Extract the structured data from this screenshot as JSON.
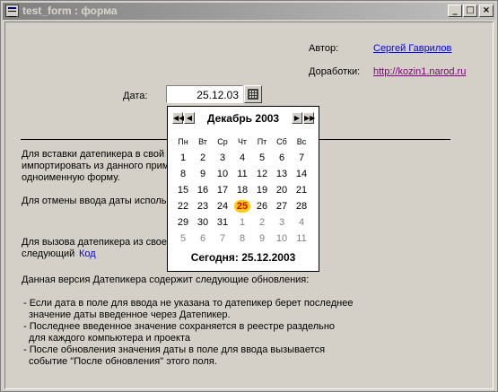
{
  "window": {
    "title": "test_form : форма"
  },
  "header": {
    "author_label": "Автор:",
    "author_link": "Сергей Гаврилов",
    "mods_label": "Доработки:",
    "mods_link": "http://kozin1.narod.ru"
  },
  "date_field": {
    "label": "Дата:",
    "value": "25.12.03"
  },
  "body_text": {
    "p1_line1": "Для вставки датепикера в свой",
    "p1_line2": "импортировать из данного прим",
    "p1_line3": "одноименную форму.",
    "p2_line1": "Для отмены ввода даты исполь",
    "p3_line1": "Для вызова датепикера из свое",
    "p3_line2": "следующий",
    "p3_link": "Код",
    "p4_line1": "Данная версия Датепикера содержит следующие обновления:",
    "b1_line1": "- Если дата в поле для ввода не указана то датепикер берет последнее",
    "b1_line2": "  значение даты введенное через Датепикер.",
    "b2_line1": "- Последнее введенное значение сохраняется в реестре раздельно",
    "b2_line2": "  для каждого компьютера и проекта",
    "b3_line1": "- После обновления значения даты в поле для ввода вызывается",
    "b3_line2": "  событие \"После обновления\" этого поля."
  },
  "calendar": {
    "month_year": "Декабрь 2003",
    "nav_prev_year": "◀◀",
    "nav_prev_month": "◀",
    "nav_next_month": "▶",
    "nav_next_year": "▶▶",
    "weekdays": [
      "Пн",
      "Вт",
      "Ср",
      "Чт",
      "Пт",
      "Сб",
      "Вс"
    ],
    "weeks": [
      [
        "1",
        "2",
        "3",
        "4",
        "5",
        "6",
        "7"
      ],
      [
        "8",
        "9",
        "10",
        "11",
        "12",
        "13",
        "14"
      ],
      [
        "15",
        "16",
        "17",
        "18",
        "19",
        "20",
        "21"
      ],
      [
        "22",
        "23",
        "24",
        "25",
        "26",
        "27",
        "28"
      ],
      [
        "29",
        "30",
        "31",
        "1",
        "2",
        "3",
        "4"
      ],
      [
        "5",
        "6",
        "7",
        "8",
        "9",
        "10",
        "11"
      ]
    ],
    "selected_day": "25",
    "today_text": "Сегодня: 25.12.2003"
  }
}
